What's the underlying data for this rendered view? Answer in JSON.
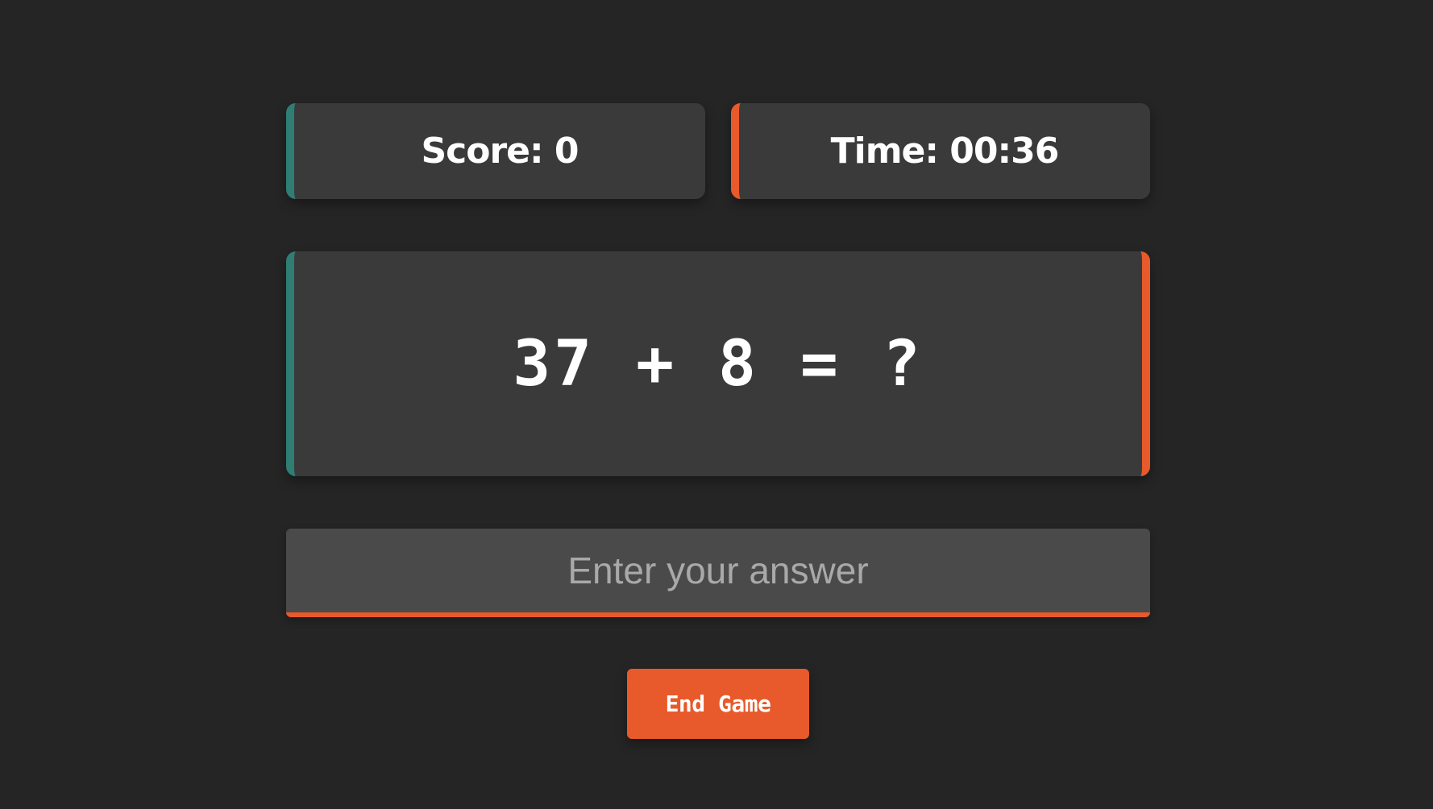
{
  "scoreboard": {
    "score_text": "Score: 0",
    "time_text": "Time: 00:36"
  },
  "question": {
    "text": "37 + 8 = ?"
  },
  "answer_input": {
    "value": "",
    "placeholder": "Enter your answer"
  },
  "controls": {
    "end_game_label": "End Game"
  },
  "colors": {
    "background": "#252525",
    "card": "#3a3a3a",
    "teal_accent": "#2f7d73",
    "orange_accent": "#e85a2b"
  }
}
